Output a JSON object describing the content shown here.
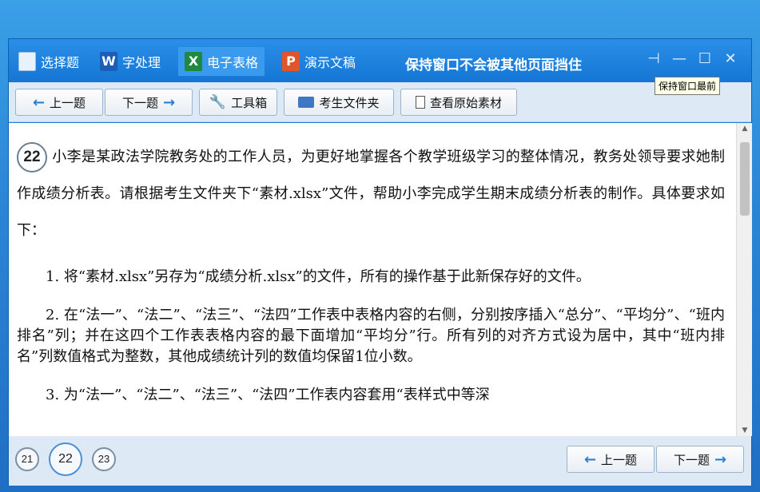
{
  "tabs": [
    {
      "label": "选择题",
      "icon": "document-icon"
    },
    {
      "label": "字处理",
      "icon": "word-icon",
      "glyph": "W"
    },
    {
      "label": "电子表格",
      "icon": "excel-icon",
      "glyph": "X"
    },
    {
      "label": "演示文稿",
      "icon": "powerpoint-icon",
      "glyph": "P"
    }
  ],
  "pin_notice": "保持窗口不会被其他页面挡住",
  "tooltip": "保持窗口最前",
  "window_controls": {
    "pin": "⊣",
    "minimize": "—",
    "maximize": "☐",
    "close": "✕"
  },
  "toolbar": {
    "prev": "上一题",
    "next": "下一题",
    "tools": "工具箱",
    "folder": "考生文件夹",
    "material": "查看原始素材"
  },
  "question": {
    "number": "22",
    "intro": "小李是某政法学院教务处的工作人员，为更好地掌握各个教学班级学习的整体情况，教务处领导要求她制作成绩分析表。请根据考生文件夹下“素材.xlsx”文件，帮助小李完成学生期末成绩分析表的制作。具体要求如下：",
    "item1": "1. 将“素材.xlsx”另存为“成绩分析.xlsx”的文件，所有的操作基于此新保存好的文件。",
    "item2": "2. 在“法一”、“法二”、“法三”、“法四”工作表中表格内容的右侧，分别按序插入“总分”、“平均分”、“班内排名”列；并在这四个工作表表格内容的最下面增加“平均分”行。所有列的对齐方式设为居中，其中“班内排名”列数值格式为整数，其他成绩统计列的数值均保留1位小数。",
    "item3": "3. 为“法一”、“法二”、“法三”、“法四”工作表内容套用“表样式中等深"
  },
  "question_nav": [
    "21",
    "22",
    "23"
  ],
  "footer": {
    "prev": "上一题",
    "next": "下一题"
  },
  "colors": {
    "title_blue": "#1576d4",
    "toolbar_bg": "#dde9f5",
    "arrow_blue": "#2a7fd0"
  }
}
